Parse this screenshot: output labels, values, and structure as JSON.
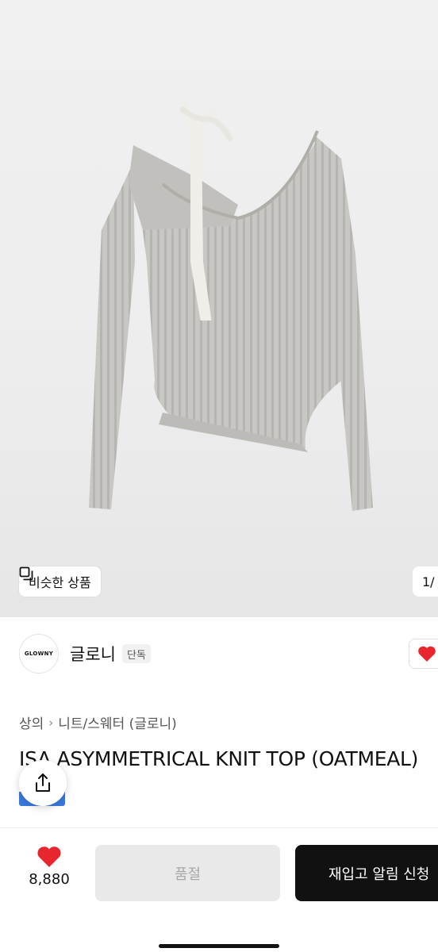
{
  "gallery": {
    "similar_label": "비슷한 상품",
    "counter": "1/"
  },
  "brand": {
    "logo_text": "GLOWNY",
    "name": "글로니",
    "badge": "단독"
  },
  "breadcrumb": {
    "category": "상의",
    "subcategory": "니트/스웨터 (글로니)"
  },
  "product": {
    "title": "ISA ASYMMETRICAL KNIT TOP (OATMEAL)"
  },
  "bottom_bar": {
    "like_count": "8,880",
    "soldout_label": "품절",
    "restock_label": "재입고 알림 신청"
  },
  "colors": {
    "accent_red": "#e8262d",
    "primary_button": "#111111",
    "disabled_button": "#e9e9e9",
    "blue_chip": "#3a7ae0"
  },
  "icons": {
    "similar": "copy-icon",
    "like": "heart-icon",
    "share": "share-icon"
  }
}
